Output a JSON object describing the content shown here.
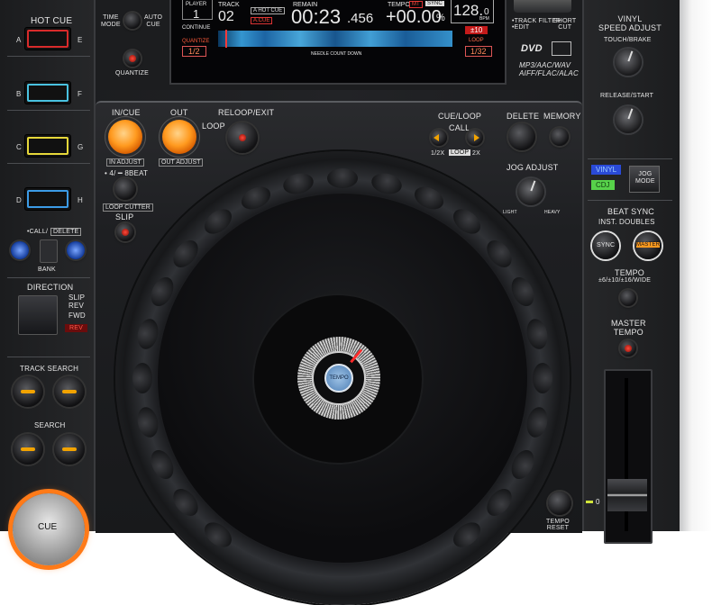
{
  "left_panel": {
    "hot_cue": "HOT CUE",
    "pad_letters_left": [
      "A",
      "B",
      "C",
      "D"
    ],
    "pad_letters_right": [
      "E",
      "F",
      "G",
      "H"
    ],
    "pad_colors": [
      "#d92b2b",
      "#49c2e0",
      "#e6d83a",
      "#3c9be6"
    ],
    "call_delete": "•CALL/",
    "delete_label": "DELETE",
    "bank": "BANK",
    "direction": "DIRECTION",
    "slip_rev": "SLIP",
    "rev_label": "REV",
    "fwd": "FWD",
    "rev_badge": "REV",
    "track_search": "TRACK SEARCH",
    "search": "SEARCH",
    "cue": "CUE"
  },
  "top": {
    "time_mode": "TIME\nMODE",
    "auto_cue": "AUTO\nCUE",
    "quantize": "QUANTIZE",
    "track_filter": "•TRACK FILTER\n•EDIT",
    "short_cut": "SHORT\nCUT",
    "formats": "MP3/AAC/WAV\nAIFF/FLAC/ALAC",
    "dvd": "DVD"
  },
  "display": {
    "player_label": "PLAYER",
    "player_value": "1",
    "continue_label": "CONTINUE",
    "track_label": "TRACK",
    "track_value": "02",
    "a_hotcue": "A HOT CUE",
    "a_cue": "A.CUE",
    "remain_label": "REMAIN",
    "time_main": "00:23",
    "time_frac": ".456",
    "tempo_label": "TEMPO",
    "mt_label": "MT",
    "sync_label": "SYNC",
    "tempo_value": "+00.00",
    "tempo_unit": "%",
    "bpm_value": "128.",
    "bpm_frac": "0",
    "bpm_unit": "BPM",
    "range_value": "±10",
    "loop_label": "LOOP",
    "loop_value": "1/32",
    "quantize_label": "QUANTIZE",
    "quantize_value": "1/2",
    "needle": "NEEDLE COUNT DOWN"
  },
  "main": {
    "in_cue": "IN/CUE",
    "out": "OUT",
    "loop": "LOOP",
    "reloop_exit": "RELOOP/EXIT",
    "in_adjust": "IN ADJUST",
    "out_adjust": "OUT ADJUST",
    "beat": "• 4/ ━ 8BEAT",
    "loop_cutter": "LOOP CUTTER",
    "slip": "SLIP",
    "cue_loop": "CUE/LOOP",
    "call": "CALL",
    "delete": "DELETE",
    "memory": "MEMORY",
    "half": "1/2X",
    "loop_tag": "LOOP",
    "double": "2X",
    "jog_adjust": "JOG ADJUST",
    "light": "LIGHT",
    "heavy": "HEAVY",
    "tempo_reset": "TEMPO\nRESET",
    "center_label": "TEMPO"
  },
  "right_panel": {
    "vinyl_speed": "VINYL\nSPEED ADJUST",
    "touch_brake": "TOUCH/BRAKE",
    "release_start": "RELEASE/START",
    "vinyl": "VINYL",
    "cdj": "CDJ",
    "jog_mode": "JOG\nMODE",
    "beat_sync": "BEAT SYNC",
    "inst_doubles": "INST. DOUBLES",
    "sync": "SYNC",
    "master": "MASTER",
    "tempo": "TEMPO",
    "tempo_range": "±6/±10/±16/WIDE",
    "master_tempo": "MASTER\nTEMPO",
    "fader_zero": "0"
  }
}
